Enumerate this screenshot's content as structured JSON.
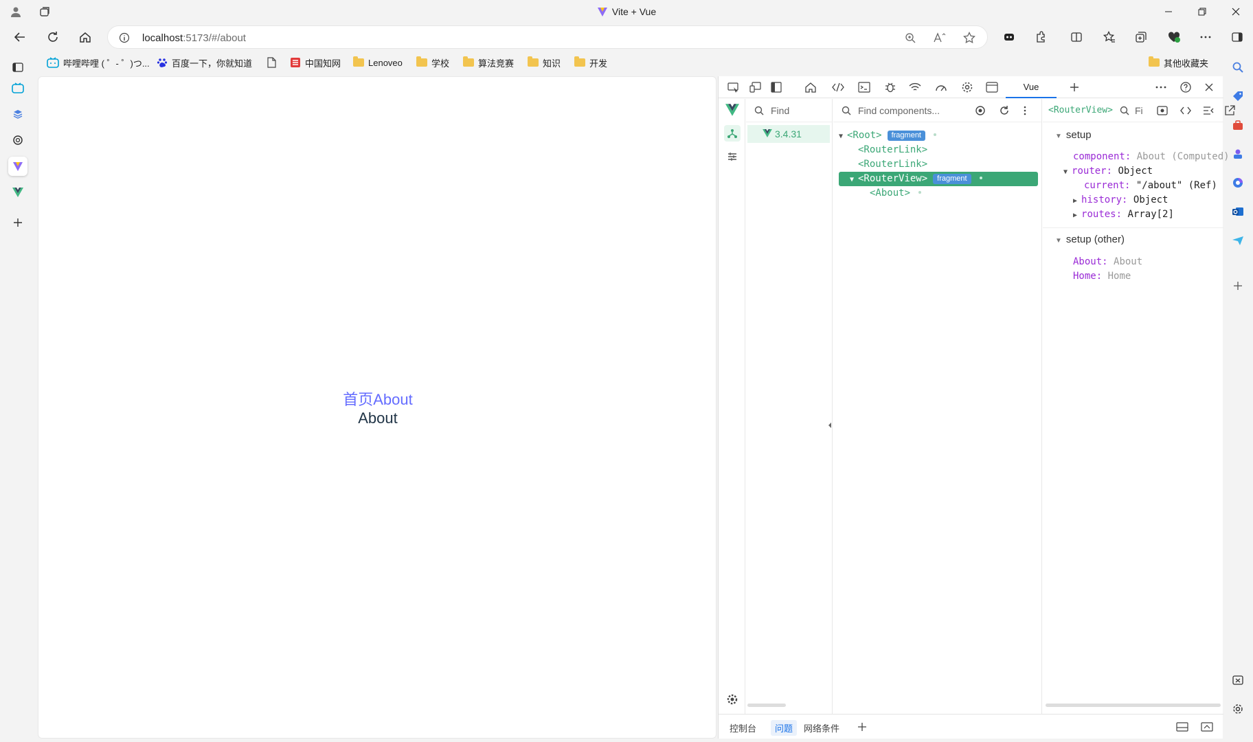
{
  "window": {
    "title": "Vite + Vue"
  },
  "nav": {
    "url_host": "localhost",
    "url_path": ":5173/#/about"
  },
  "bookmarks": [
    {
      "label": "哔哩哔哩 ( ゜- ゜)つ..."
    },
    {
      "label": "百度一下，你就知道"
    },
    {
      "label": "中国知网"
    },
    {
      "label": "Lenoveo"
    },
    {
      "label": "学校"
    },
    {
      "label": "算法竞赛"
    },
    {
      "label": "知识"
    },
    {
      "label": "开发"
    }
  ],
  "bookmarks_other": "其他收藏夹",
  "page": {
    "link_home": "首页",
    "link_about": "About",
    "content": "About"
  },
  "devtools": {
    "active_tab": "Vue",
    "apps_search": "Find",
    "version": "3.4.31",
    "tree_search": "Find components...",
    "state_header": "<RouterView>",
    "state_search": "Fi",
    "tree": [
      {
        "label": "<Root>",
        "badge": "fragment"
      },
      {
        "label": "<RouterLink>"
      },
      {
        "label": "<RouterLink>"
      },
      {
        "label": "<RouterView>",
        "badge": "fragment"
      },
      {
        "label": "<About>"
      }
    ],
    "setup": {
      "title": "setup",
      "component_key": "component:",
      "component_val": "About (Computed)",
      "router_key": "router:",
      "router_val": "Object",
      "current_key": "current:",
      "current_val": "\"/about\" (Ref)",
      "history_key": "history:",
      "history_val": "Object",
      "routes_key": "routes:",
      "routes_val": "Array[2]"
    },
    "setup_other": {
      "title": "setup (other)",
      "about_key": "About:",
      "about_val": "About",
      "home_key": "Home:",
      "home_val": "Home"
    },
    "bottom_tabs": [
      "控制台",
      "问题",
      "网络条件"
    ]
  },
  "colors": {
    "vue_green": "#3ba776",
    "link": "#646cff",
    "accent": "#1a73e8"
  }
}
